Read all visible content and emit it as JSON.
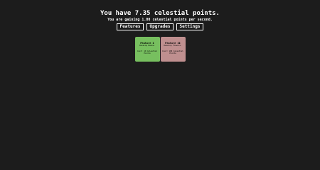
{
  "header": {
    "points_line": "You have 7.35 celestial points.",
    "rate_line": "You are gaining 1.00 celestial points per second."
  },
  "tabs": [
    {
      "label": "Features"
    },
    {
      "label": "Upgrades"
    },
    {
      "label": "Settings"
    }
  ],
  "cards": [
    {
      "title": "Feature I",
      "desc": "Develop Beans.",
      "cost_line1": "Cost: 10 Celestial",
      "cost_line2": "Points",
      "status": "bought",
      "color": "#77bf5f"
    },
    {
      "title": "Feature II",
      "desc": "Develop Flowers.",
      "cost_line1": "Cost: 100 Celestial",
      "cost_line2": "Points",
      "status": "locked",
      "color": "#bf8f8f"
    }
  ]
}
